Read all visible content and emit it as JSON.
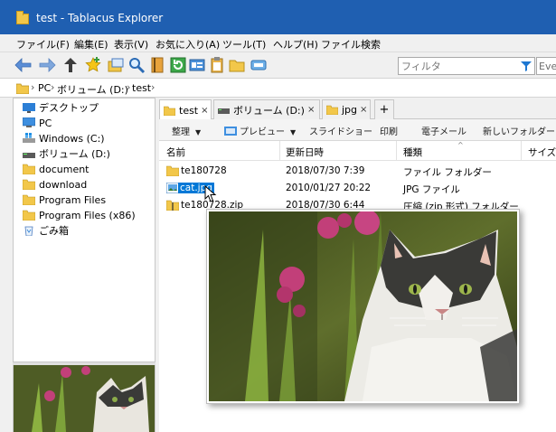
{
  "window": {
    "title": "test - Tablacus Explorer",
    "title_color": "#1f5fb1",
    "selection_color": "#0078d7"
  },
  "menu": [
    "ファイル(F)",
    "編集(E)",
    "表示(V)",
    "お気に入り(A)",
    "ツール(T)",
    "ヘルプ(H)",
    "ファイル検索"
  ],
  "toolbar": {
    "icons": [
      "back-arrow-icon",
      "forward-arrow-icon",
      "up-arrow-icon",
      "add-favorite-star-icon",
      "new-window-icon",
      "search-magnifier-icon",
      "bookmark-icon",
      "refresh-icon",
      "properties-icon",
      "clipboard-icon",
      "new-folder-icon",
      "rename-icon"
    ],
    "filter_placeholder": "フィルタ",
    "every_label": "Every"
  },
  "address": {
    "crumbs": [
      "PC",
      "ボリューム (D:)",
      "test"
    ]
  },
  "tree": {
    "items": [
      {
        "label": "デスクトップ",
        "icon": "desktop-icon"
      },
      {
        "label": "PC",
        "icon": "computer-icon"
      },
      {
        "label": "Windows (C:)",
        "icon": "windows-drive-icon"
      },
      {
        "label": "ボリューム (D:)",
        "icon": "drive-icon"
      },
      {
        "label": "document",
        "icon": "folder-icon"
      },
      {
        "label": "download",
        "icon": "folder-icon"
      },
      {
        "label": "Program Files",
        "icon": "folder-icon"
      },
      {
        "label": "Program Files (x86)",
        "icon": "folder-icon"
      },
      {
        "label": "ごみ箱",
        "icon": "recycle-bin-icon"
      }
    ]
  },
  "tabs": {
    "items": [
      {
        "label": "test",
        "close": "×",
        "active": true
      },
      {
        "label": "ボリューム (D:)",
        "close": "×",
        "active": false
      },
      {
        "label": "jpg",
        "close": "×",
        "active": false
      }
    ],
    "add_label": "+"
  },
  "commands": {
    "organize": "整理",
    "preview": "プレビュー",
    "slideshow": "スライドショー",
    "print": "印刷",
    "email": "電子メール",
    "new_folder": "新しいフォルダー"
  },
  "columns": {
    "name": "名前",
    "modified": "更新日時",
    "type": "種類",
    "size": "サイズ"
  },
  "files": [
    {
      "name": "te180728",
      "date": "2018/07/30 7:39",
      "type": "ファイル フォルダー",
      "icon": "folder-icon"
    },
    {
      "name": "cat.jpg",
      "date": "2010/01/27 20:22",
      "type": "JPG ファイル",
      "icon": "image-file-icon"
    },
    {
      "name": "te180728.zip",
      "date": "2018/07/30 6:44",
      "type": "圧縮 (zip 形式) フォルダー",
      "icon": "zip-folder-icon"
    }
  ]
}
